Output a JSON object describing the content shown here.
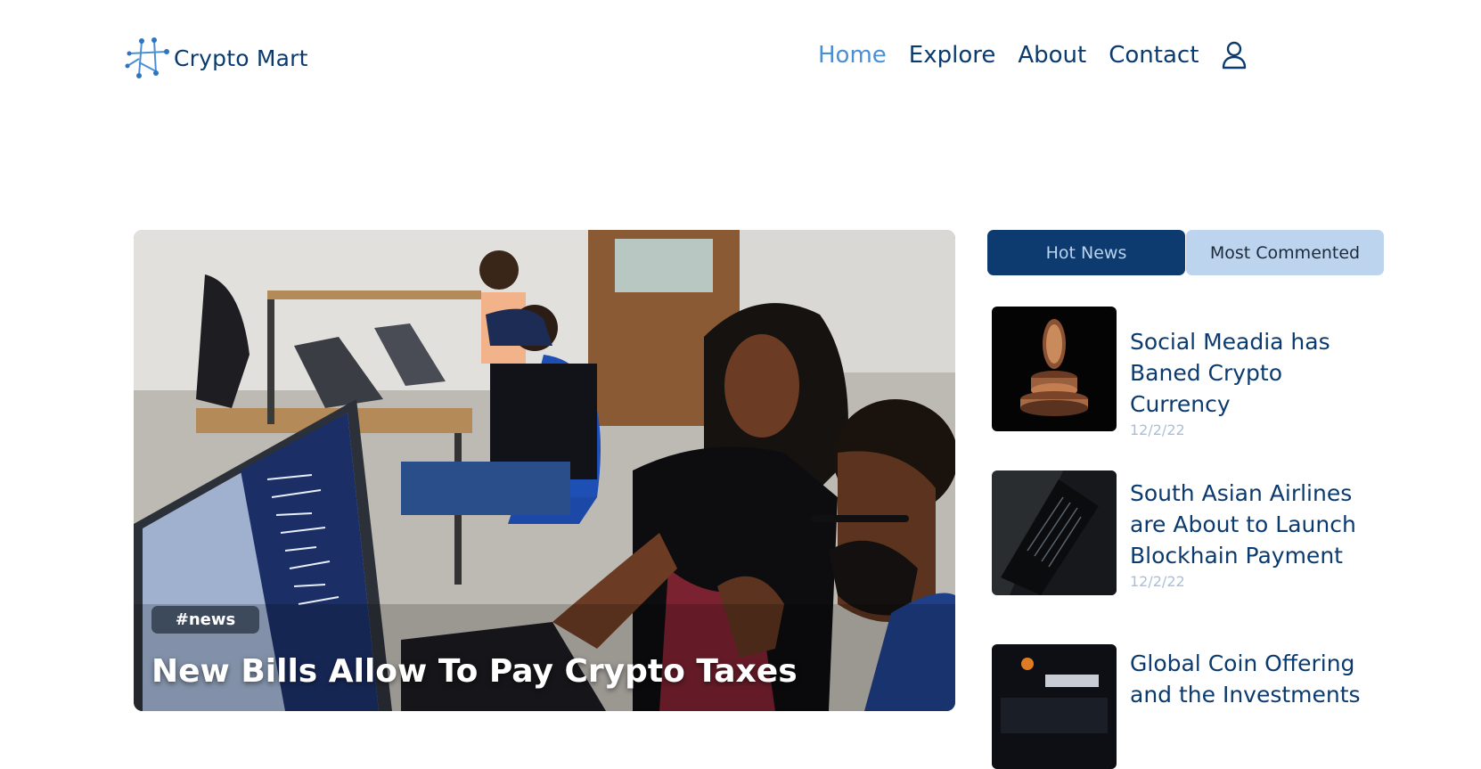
{
  "brand": {
    "name": "Crypto Mart",
    "logo_icon": "constellation-logo-icon"
  },
  "nav": {
    "items": [
      {
        "label": "Home",
        "active": true
      },
      {
        "label": "Explore",
        "active": false
      },
      {
        "label": "About",
        "active": false
      },
      {
        "label": "Contact",
        "active": false
      }
    ],
    "user_icon": "user-icon"
  },
  "hero": {
    "tag": "#news",
    "title": "New Bills Allow To Pay Crypto Taxes"
  },
  "sidebar": {
    "tabs": [
      {
        "label": "Hot News",
        "active": true
      },
      {
        "label": "Most Commented",
        "active": false
      }
    ],
    "news": [
      {
        "title": "Social Meadia has Baned Crypto Currency",
        "date": "12/2/22"
      },
      {
        "title": "South Asian Airlines are About to Launch Blockhain Payment",
        "date": "12/2/22"
      },
      {
        "title": "Global Coin Offering and the Investments",
        "date": ""
      }
    ]
  },
  "colors": {
    "primary": "#0b3a6e",
    "accent": "#4a8fd6",
    "tab_inactive": "#bcd4ee",
    "date": "#a8bfd8"
  }
}
